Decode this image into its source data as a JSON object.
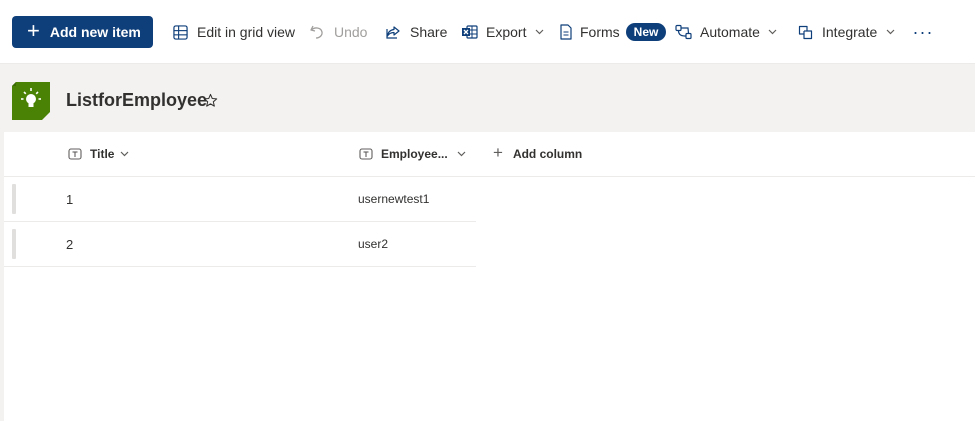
{
  "commandbar": {
    "add_new_item": "Add new item",
    "edit_grid": "Edit in grid view",
    "undo": "Undo",
    "share": "Share",
    "export": "Export",
    "forms": "Forms",
    "forms_badge": "New",
    "automate": "Automate",
    "integrate": "Integrate",
    "more": "···"
  },
  "header": {
    "title": "ListforEmployee",
    "icon": "lightbulb-icon",
    "brand_color": "#498205"
  },
  "columns": {
    "title": "Title",
    "employee": "Employee...",
    "add_column": "Add column"
  },
  "rows": [
    {
      "title": "1",
      "employee": "usernewtest1"
    },
    {
      "title": "2",
      "employee": "user2"
    }
  ],
  "colors": {
    "primary": "#0f3f7a",
    "text": "#323130",
    "disabled": "#a19f9d"
  }
}
